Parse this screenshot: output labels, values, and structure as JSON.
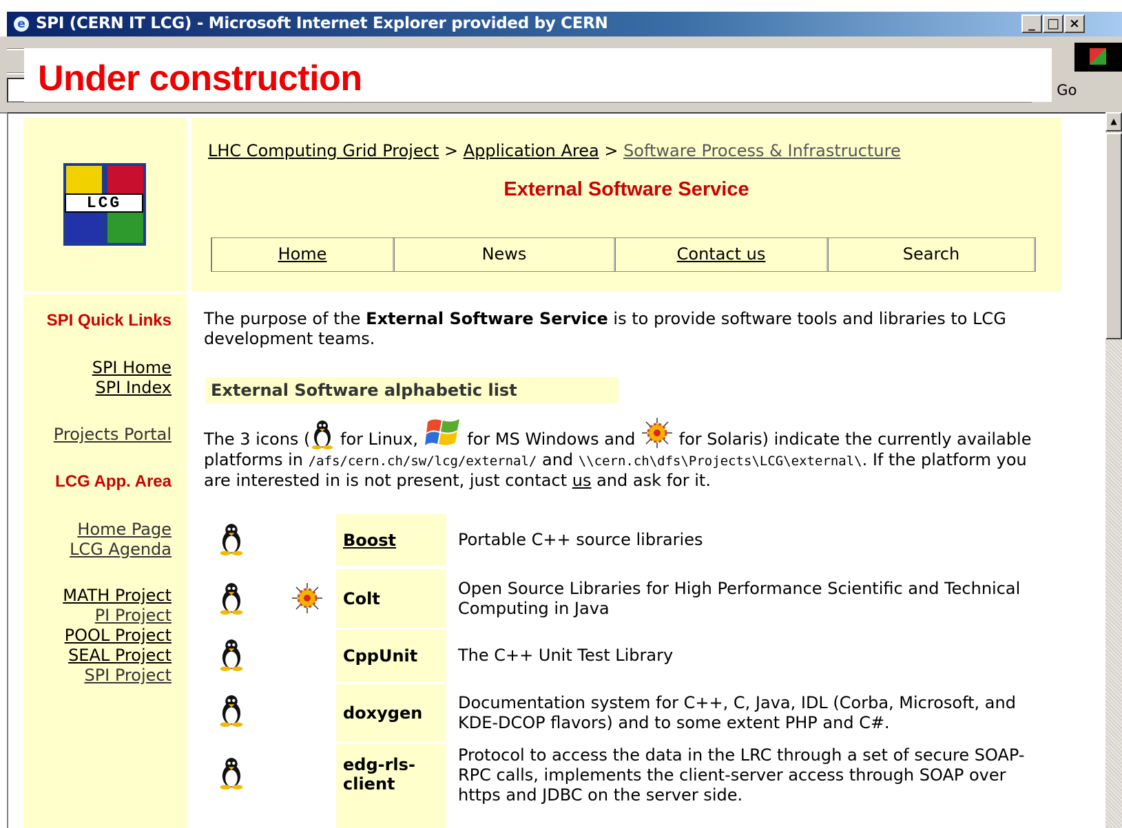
{
  "window": {
    "title": "SPI (CERN IT LCG) - Microsoft Internet Explorer provided by CERN",
    "ie_icon": "e",
    "btn_min": "_",
    "btn_max": "□",
    "btn_close": "×"
  },
  "toolbar": {
    "go_label": "Go",
    "go_icon": "↷"
  },
  "banner": {
    "text": "Under construction",
    "color": "#ee0000"
  },
  "logo": {
    "text": "LCG"
  },
  "breadcrumb": {
    "item1": "LHC Computing Grid Project",
    "sep1": " > ",
    "item2": "Application Area",
    "sep2": " > ",
    "item3": "Software Process & Infrastructure"
  },
  "service_title": "External Software Service",
  "nav": {
    "home": "Home",
    "news": "News",
    "contact": "Contact us",
    "search": "Search"
  },
  "sidebar": {
    "quick_links_head": "SPI Quick Links",
    "spi_home": "SPI Home",
    "spi_index": "SPI Index",
    "projects_portal": "Projects Portal",
    "app_area_head": "LCG App. Area",
    "home_page": "Home Page",
    "lcg_agenda": "LCG Agenda",
    "math_project": "MATH Project",
    "pi_project": "PI Project",
    "pool_project": "POOL Project",
    "seal_project": "SEAL Project",
    "spi_project": "SPI Project"
  },
  "intro": {
    "before": "The purpose of the ",
    "bold": "External Software Service",
    "after": " is to provide software tools and libraries to LCG development teams."
  },
  "section_heading": "External Software alphabetic list",
  "icons_para": {
    "p1": "The 3 icons (",
    "p2": " for Linux, ",
    "p3": " for MS Windows and ",
    "p4": " for Solaris) indicate the currently available platforms in ",
    "path1": "/afs/cern.ch/sw/lcg/external/",
    "p5": " and ",
    "path2": "\\\\cern.ch\\dfs\\Projects\\LCG\\external\\",
    "p6": ". If the platform you are interested in is not present, just contact ",
    "us": "us",
    "p7": " and ask for it."
  },
  "packages": [
    {
      "name": "Boost",
      "desc": "Portable C++ source libraries",
      "linked": true,
      "platforms": [
        "linux"
      ]
    },
    {
      "name": "Colt",
      "desc": "Open Source Libraries for High Performance Scientific and Technical Computing in Java",
      "linked": false,
      "platforms": [
        "linux",
        "solaris"
      ]
    },
    {
      "name": "CppUnit",
      "desc": "The C++ Unit Test Library",
      "linked": false,
      "platforms": [
        "linux"
      ]
    },
    {
      "name": "doxygen",
      "desc": "Documentation system for C++, C, Java, IDL (Corba, Microsoft, and KDE-DCOP flavors) and to some extent PHP and C#.",
      "linked": false,
      "platforms": [
        "linux"
      ]
    },
    {
      "name": "edg-rls-client",
      "desc": "Protocol to access the data in the LRC through a set of secure SOAP-RPC calls, implements the client-server access through SOAP over https and JDBC on the server side.",
      "linked": false,
      "platforms": [
        "linux"
      ]
    }
  ],
  "colors": {
    "pale_yellow": "#ffffcc",
    "title_red": "#cc0000",
    "titlebar_blue": "#0a246a"
  }
}
